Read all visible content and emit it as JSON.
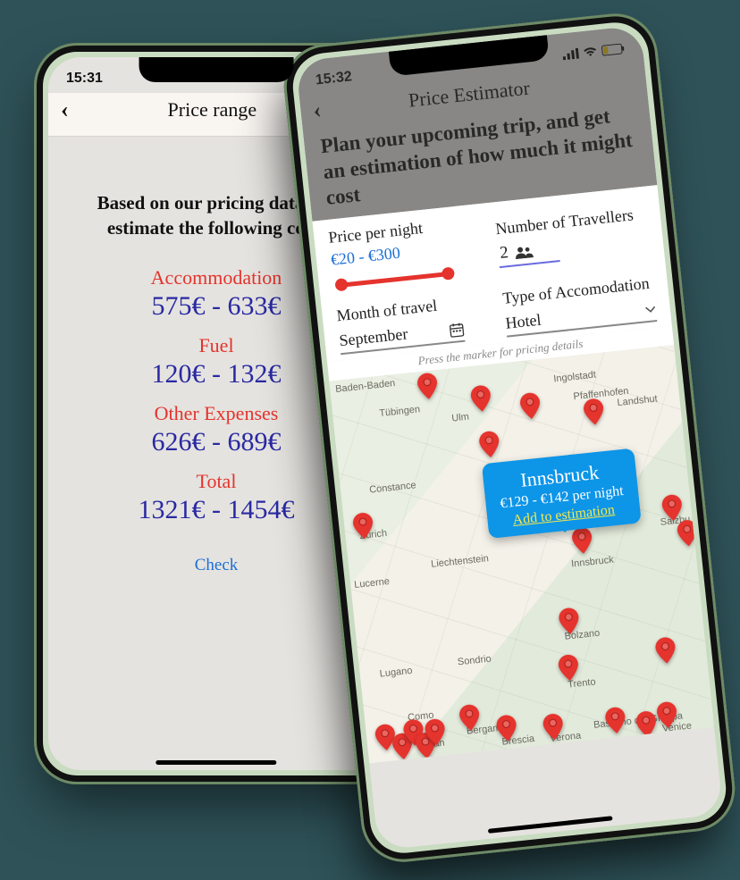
{
  "phoneA": {
    "time": "15:31",
    "title": "Price range",
    "intro": "Based on our pricing data, we estimate the following costs",
    "lines": [
      {
        "label": "Accommodation",
        "value": "575€ - 633€"
      },
      {
        "label": "Fuel",
        "value": "120€ - 132€"
      },
      {
        "label": "Other Expenses",
        "value": "626€ - 689€"
      },
      {
        "label": "Total",
        "value": "1321€ - 1454€"
      }
    ],
    "check_link": "Check"
  },
  "phoneB": {
    "time": "15:32",
    "title": "Price Estimator",
    "tagline": "Plan your upcoming trip, and get an estimation of how much it might cost",
    "price_per_night_label": "Price per night",
    "price_per_night_value": "€20 - €300",
    "travellers_label": "Number of Travellers",
    "travellers_value": "2",
    "month_label": "Month of travel",
    "month_value": "September",
    "type_label": "Type of Accomodation",
    "type_value": "Hotel",
    "map_hint": "Press the marker for pricing details",
    "callout": {
      "city": "Innsbruck",
      "price": "€129 - €142 per night",
      "link": "Add to estimation"
    },
    "cities": {
      "baden": "Baden-Baden",
      "tubingen": "Tübingen",
      "ulm": "Ulm",
      "ingolstadt": "Ingolstadt",
      "pfaffenh": "Pfaffenhofen",
      "landshut": "Landshut",
      "constance": "Constance",
      "zurich": "Zürich",
      "lucerne": "Lucerne",
      "liecht": "Liechtenstein",
      "innsbruck": "Innsbruck",
      "salzburg": "Salzbu",
      "lugano": "Lugano",
      "sondrio": "Sondrio",
      "bolzano": "Bolzano",
      "trento": "Trento",
      "como": "Como",
      "milan": "Milan",
      "bergamo": "Bergamo",
      "brescia": "Brescia",
      "verona": "Verona",
      "venice": "Venice",
      "bassano": "Bassano del Grappa"
    }
  }
}
